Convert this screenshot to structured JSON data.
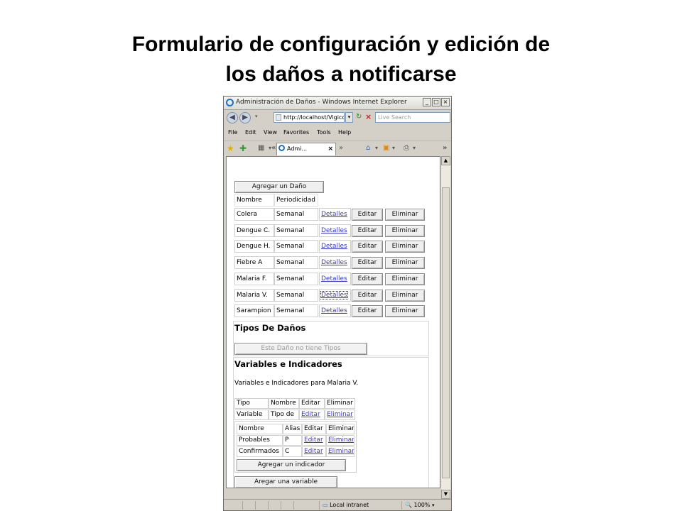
{
  "slide": {
    "title_line1": "Formulario de configuración y edición de",
    "title_line2": "los daños a notificarse"
  },
  "browser": {
    "window_title": "Administración de Daños - Windows Internet Explorer",
    "window_buttons": [
      "_",
      "□",
      "×"
    ],
    "address": "http://localhost/Vigico",
    "search_placeholder": "Live Search",
    "menu": [
      "File",
      "Edit",
      "View",
      "Favorites",
      "Tools",
      "Help"
    ],
    "tab_label": "Admi...",
    "status": {
      "zone": "Local intranet",
      "zoom": "100%"
    }
  },
  "page": {
    "add_dano_button": "Agregar un Daño",
    "danos_headers": [
      "Nombre",
      "Periodicidad"
    ],
    "danos": [
      {
        "nombre": "Colera",
        "periodicidad": "Semanal",
        "detalles": "Detalles",
        "editar": "Editar",
        "eliminar": "Eliminar"
      },
      {
        "nombre": "Dengue C.",
        "periodicidad": "Semanal",
        "detalles": "Detalles",
        "editar": "Editar",
        "eliminar": "Eliminar"
      },
      {
        "nombre": "Dengue H.",
        "periodicidad": "Semanal",
        "detalles": "Detalles",
        "editar": "Editar",
        "eliminar": "Eliminar"
      },
      {
        "nombre": "Fiebre A",
        "periodicidad": "Semanal",
        "detalles": "Detalles",
        "editar": "Editar",
        "eliminar": "Eliminar"
      },
      {
        "nombre": "Malaria F.",
        "periodicidad": "Semanal",
        "detalles": "Detalles",
        "editar": "Editar",
        "eliminar": "Eliminar"
      },
      {
        "nombre": "Malaria V.",
        "periodicidad": "Semanal",
        "detalles": "Detalles",
        "editar": "Editar",
        "eliminar": "Eliminar"
      },
      {
        "nombre": "Sarampion",
        "periodicidad": "Semanal",
        "detalles": "Detalles",
        "editar": "Editar",
        "eliminar": "Eliminar"
      }
    ],
    "tipos_heading": "Tipos De Daños",
    "tipos_button": "Este Daño no tiene Tipos",
    "variables_heading": "Variables e Indicadores",
    "variables_caption": "Variables e Indicadores para Malaria V.",
    "variables_headers": [
      "Tipo",
      "Nombre",
      "Editar",
      "Eliminar"
    ],
    "variables_row": {
      "tipo": "Variable",
      "nombre": "Tipo de",
      "editar": "Editar",
      "eliminar": "Eliminar"
    },
    "indicadores_headers": [
      "Nombre",
      "Alias",
      "Editar",
      "Eliminar"
    ],
    "indicadores": [
      {
        "nombre": "Probables",
        "alias": "P",
        "editar": "Editar",
        "eliminar": "Eliminar"
      },
      {
        "nombre": "Confirmados",
        "alias": "C",
        "editar": "Editar",
        "eliminar": "Eliminar"
      }
    ],
    "add_indicador_button": "Agregar un indicador",
    "add_variable_button": "Aregar una variable"
  }
}
